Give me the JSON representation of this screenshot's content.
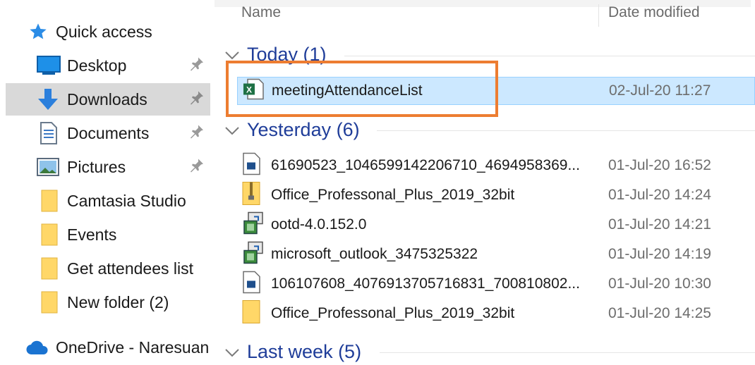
{
  "sidebar": {
    "quick_access": "Quick access",
    "items": [
      {
        "label": "Desktop",
        "icon": "desktop-icon",
        "pinned": true
      },
      {
        "label": "Downloads",
        "icon": "download-arrow-icon",
        "pinned": true,
        "selected": true
      },
      {
        "label": "Documents",
        "icon": "documents-icon",
        "pinned": true
      },
      {
        "label": "Pictures",
        "icon": "pictures-icon",
        "pinned": true
      },
      {
        "label": "Camtasia Studio",
        "icon": "folder-icon"
      },
      {
        "label": "Events",
        "icon": "folder-icon"
      },
      {
        "label": "Get attendees list",
        "icon": "folder-icon"
      },
      {
        "label": "New folder (2)",
        "icon": "folder-icon"
      }
    ],
    "onedrive": "OneDrive - Naresuan"
  },
  "columns": {
    "name": "Name",
    "date_modified": "Date modified"
  },
  "groups": [
    {
      "title": "Today (1)"
    },
    {
      "title": "Yesterday (6)"
    },
    {
      "title": "Last week (5)"
    }
  ],
  "files": {
    "today": [
      {
        "name": "meetingAttendanceList",
        "date": "02-Jul-20 11:27",
        "icon": "excel-file-icon",
        "selected": true
      }
    ],
    "yesterday": [
      {
        "name": "61690523_1046599142206710_4694958369...",
        "date": "01-Jul-20 16:52",
        "icon": "image-file-icon"
      },
      {
        "name": "Office_Professonal_Plus_2019_32bit",
        "date": "01-Jul-20 14:24",
        "icon": "zip-folder-icon"
      },
      {
        "name": "ootd-4.0.152.0",
        "date": "01-Jul-20 14:21",
        "icon": "installer-icon"
      },
      {
        "name": "microsoft_outlook_3475325322",
        "date": "01-Jul-20 14:19",
        "icon": "installer-icon"
      },
      {
        "name": "106107608_4076913705716831_700810802...",
        "date": "01-Jul-20 10:30",
        "icon": "image-file-icon"
      },
      {
        "name": "Office_Professonal_Plus_2019_32bit",
        "date": "01-Jul-20 14:25",
        "icon": "folder-icon"
      }
    ]
  },
  "colors": {
    "accent_highlight": "#ed7d31",
    "selection": "#cce8ff",
    "group_title": "#1f3d99"
  }
}
